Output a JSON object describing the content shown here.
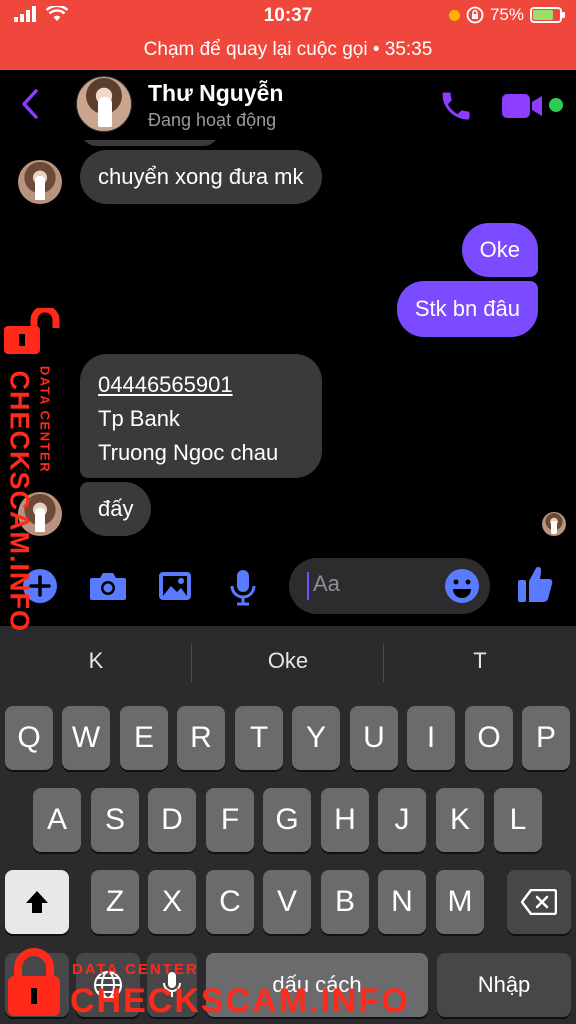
{
  "status_bar": {
    "time": "10:37",
    "battery": "75%"
  },
  "call_banner": {
    "text": "Chạm để quay lại cuộc gọi • 35:35"
  },
  "header": {
    "name": "Thư Nguyễn",
    "status": "Đang hoạt động"
  },
  "messages": [
    {
      "side": "in",
      "text": "chuyển xong đưa mk"
    },
    {
      "side": "out",
      "text": "Oke"
    },
    {
      "side": "out",
      "text": "Stk bn đâu"
    },
    {
      "side": "in",
      "lines": [
        "04446565901",
        "Tp Bank",
        "Truong Ngoc chau"
      ]
    },
    {
      "side": "in",
      "text": "đấy"
    }
  ],
  "composer": {
    "placeholder": "Aa"
  },
  "keyboard": {
    "suggestions": [
      "K",
      "Oke",
      "T"
    ],
    "row1": [
      "Q",
      "W",
      "E",
      "R",
      "T",
      "Y",
      "U",
      "I",
      "O",
      "P"
    ],
    "row2": [
      "A",
      "S",
      "D",
      "F",
      "G",
      "H",
      "J",
      "K",
      "L"
    ],
    "row3": [
      "Z",
      "X",
      "C",
      "V",
      "B",
      "N",
      "M"
    ],
    "space_label": "dấu cách",
    "return_label": "Nhập"
  },
  "watermark": {
    "side_title": "DATA CENTER",
    "side_brand": "CHECKSCAM.INFO",
    "bottom_title": "DATA CENTER",
    "bottom_brand": "CHECKSCAM.INFO"
  },
  "colors": {
    "accent": "#7b4bff",
    "banner": "#f0473d",
    "incoming": "#3a3a3c",
    "online": "#2fcc52",
    "watermark": "#ff2a1a"
  }
}
